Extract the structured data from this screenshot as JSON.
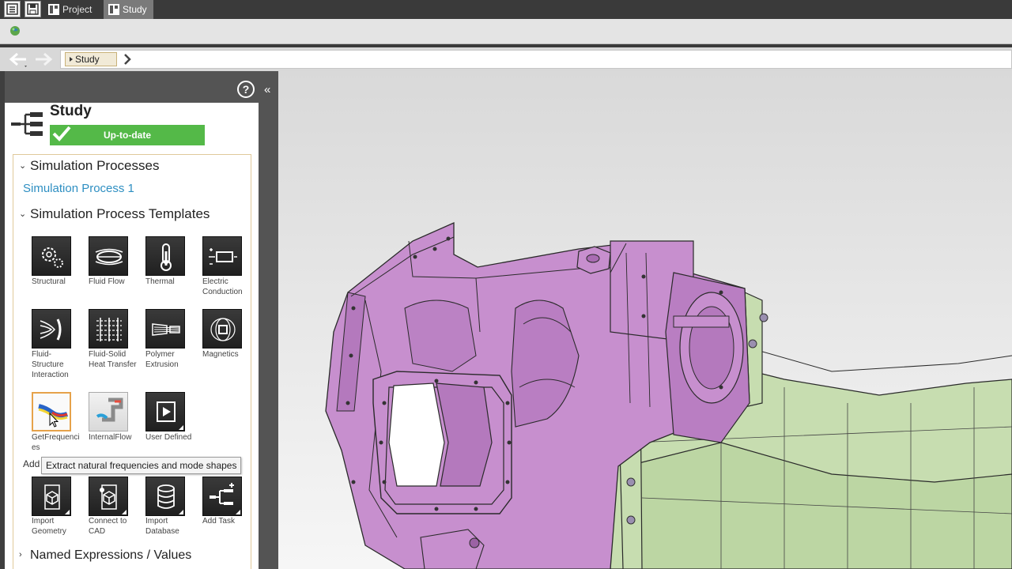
{
  "tabbar": {
    "tabs": [
      {
        "label": "Project",
        "active": false
      },
      {
        "label": "Study",
        "active": true
      }
    ]
  },
  "breadcrumb": {
    "items": [
      "Study"
    ]
  },
  "panel": {
    "title": "Study",
    "status": "Up-to-date",
    "help_symbol": "?",
    "collapse_symbol": "«",
    "sections": {
      "processes": {
        "label": "Simulation Processes",
        "items": [
          "Simulation Process 1"
        ]
      },
      "templates": {
        "label": "Simulation Process Templates",
        "items": [
          {
            "label": "Structural",
            "icon": "gears-icon"
          },
          {
            "label": "Fluid Flow",
            "icon": "fluid-flow-icon"
          },
          {
            "label": "Thermal",
            "icon": "thermometer-icon"
          },
          {
            "label": "Electric Conduction",
            "icon": "electric-conduction-icon"
          },
          {
            "label": "Fluid-Structure Interaction",
            "icon": "fsi-icon"
          },
          {
            "label": "Fluid-Solid Heat Transfer",
            "icon": "heat-transfer-icon"
          },
          {
            "label": "Polymer Extrusion",
            "icon": "extrusion-icon"
          },
          {
            "label": "Magnetics",
            "icon": "magnetics-icon"
          },
          {
            "label": "GetFrequencies",
            "icon": "frequencies-icon"
          },
          {
            "label": "InternalFlow",
            "icon": "internal-flow-icon"
          },
          {
            "label": "User Defined",
            "icon": "user-defined-icon"
          }
        ]
      },
      "add": {
        "label": "Add",
        "items": [
          {
            "label": "Import Geometry",
            "icon": "import-geometry-icon"
          },
          {
            "label": "Connect to CAD",
            "icon": "connect-cad-icon"
          },
          {
            "label": "Import Database",
            "icon": "database-icon"
          },
          {
            "label": "Add Task",
            "icon": "add-task-icon"
          }
        ]
      },
      "named": {
        "label": "Named Expressions / Values"
      }
    },
    "tooltip": "Extract natural frequencies and mode shapes"
  },
  "colors": {
    "status_green": "#54b948",
    "link_blue": "#2e8fc2",
    "part_purple": "#c78fce",
    "part_green": "#c7ddb0",
    "highlight_border": "#e6a24a"
  }
}
